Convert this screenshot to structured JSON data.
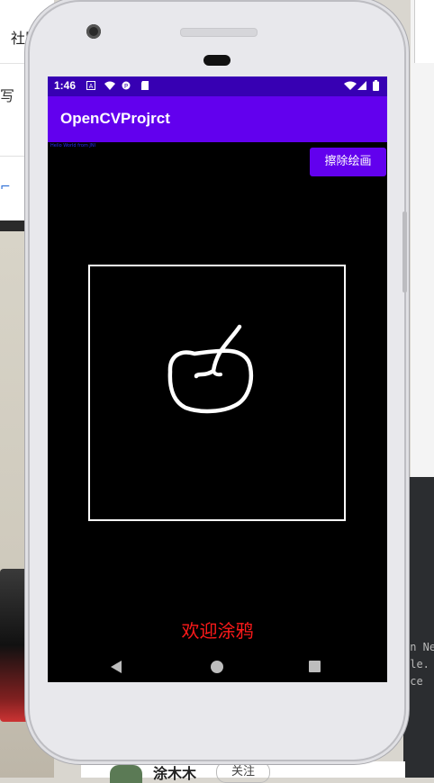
{
  "background": {
    "left_tab_text": "社区",
    "left_line_text": "写",
    "right_code_lines": [
      "on Ne",
      "ple.",
      "ice"
    ],
    "bottom_name": "涂木木",
    "bottom_follow": "关注"
  },
  "status_bar": {
    "time": "1:46",
    "color": "#3700b3"
  },
  "app_bar": {
    "title": "OpenCVProjrct",
    "color": "#6200ee"
  },
  "content": {
    "tiny_label": "Hello World from JNI",
    "erase_button_label": "擦除绘画",
    "welcome_text": "欢迎涂鸦",
    "welcome_color": "#ff1a1a"
  },
  "nav_bar": {
    "icons": [
      "back-icon",
      "home-icon",
      "recents-icon"
    ]
  }
}
